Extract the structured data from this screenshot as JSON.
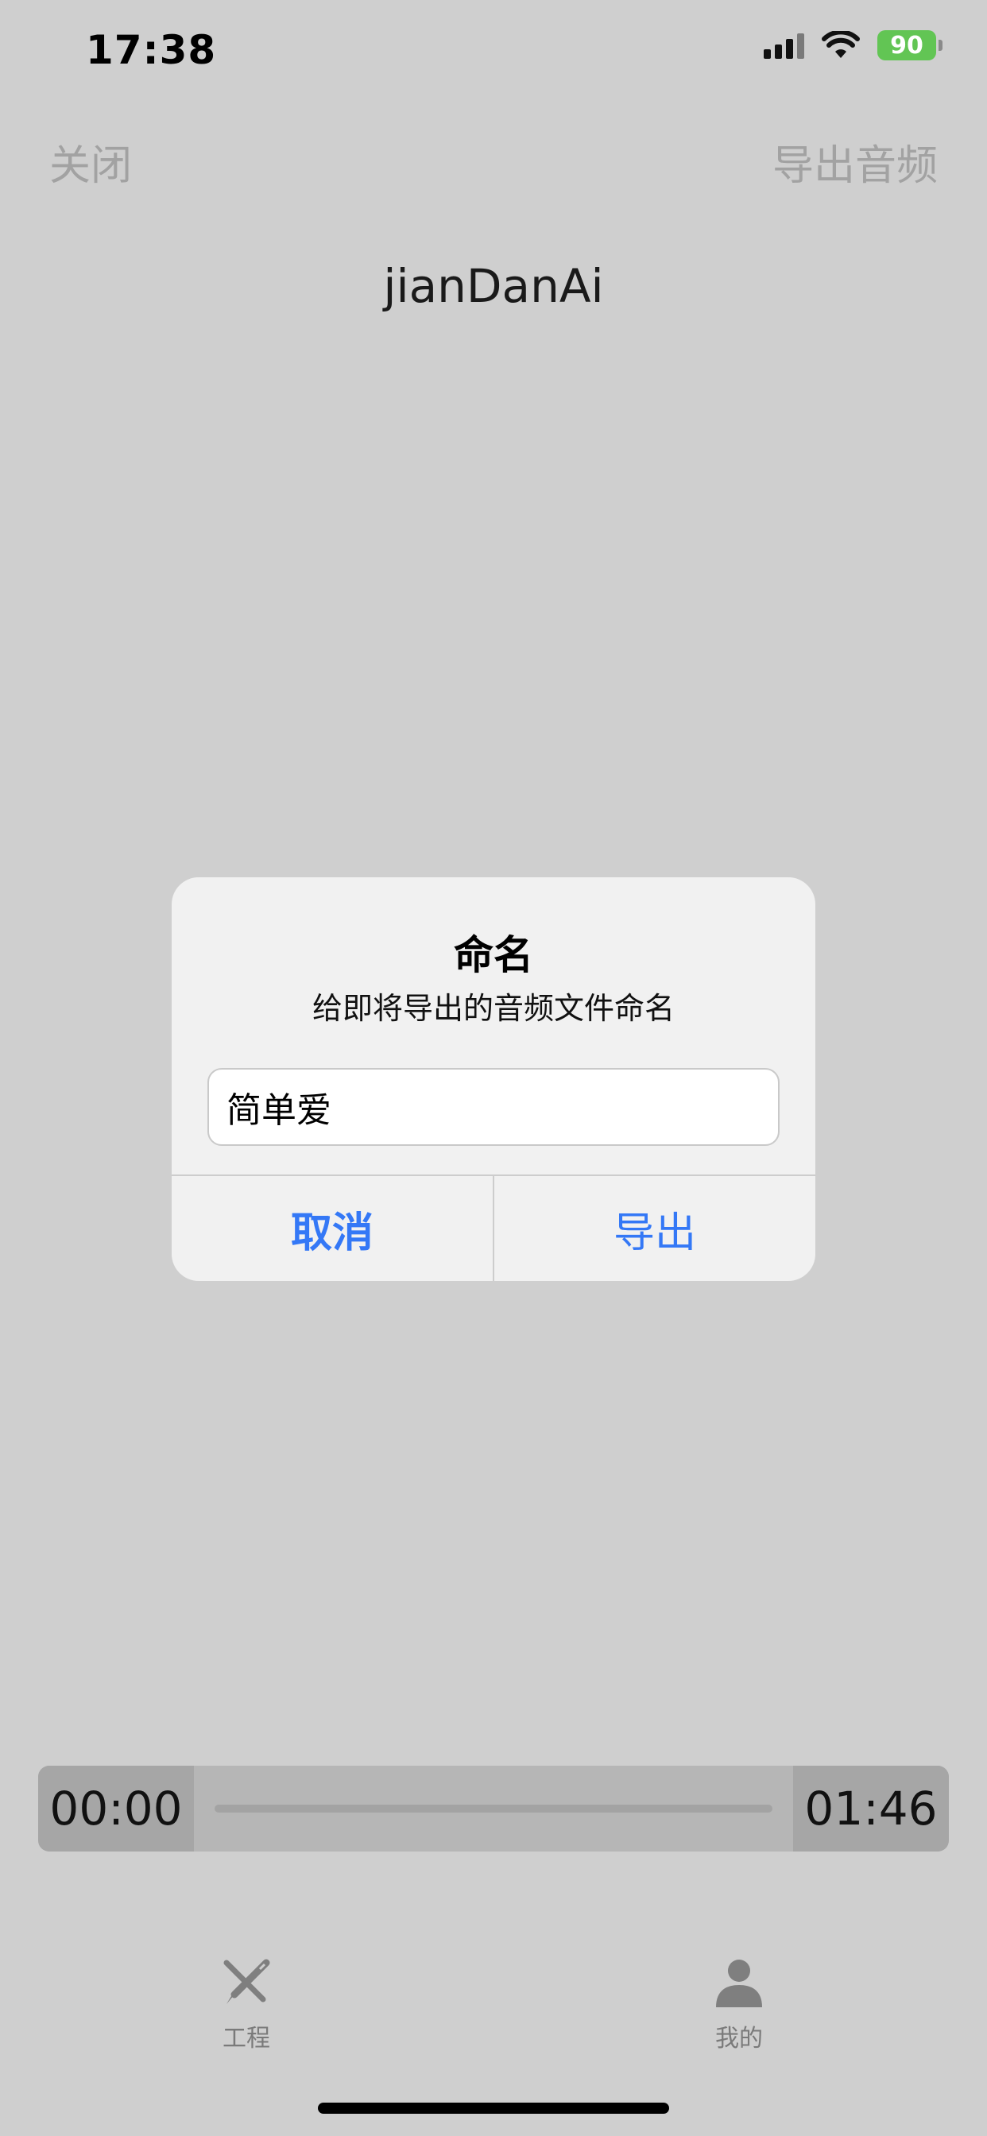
{
  "status_bar": {
    "time": "17:38",
    "battery_level": "90",
    "battery_color": "#62c554",
    "icons": [
      "signal-icon",
      "wifi-icon",
      "battery-charging-icon"
    ]
  },
  "nav": {
    "close_label": "关闭",
    "export_audio_label": "导出音频"
  },
  "project": {
    "title": "jianDanAi"
  },
  "dialog": {
    "title": "命名",
    "message": "给即将导出的音频文件命名",
    "input_value": "简单爱",
    "cancel_label": "取消",
    "export_label": "导出",
    "accent_color": "#3478f6"
  },
  "player": {
    "current_time": "00:00",
    "total_time": "01:46"
  },
  "tab_bar": {
    "items": [
      {
        "label": "工程",
        "icon": "pencil-ruler-icon"
      },
      {
        "label": "我的",
        "icon": "person-icon"
      }
    ]
  }
}
